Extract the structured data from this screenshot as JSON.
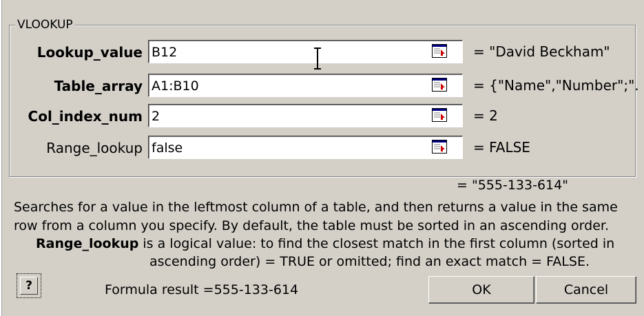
{
  "dialog": {
    "group_title": "VLOOKUP"
  },
  "args": [
    {
      "label": "Lookup_value",
      "value": "B12",
      "result": "= \"David Beckham\""
    },
    {
      "label": "Table_array",
      "value": "A1:B10",
      "result": "= {\"Name\",\"Number\";\"."
    },
    {
      "label": "Col_index_num",
      "value": "2",
      "result": "= 2"
    },
    {
      "label": "Range_lookup",
      "value": "false",
      "result": "= FALSE"
    }
  ],
  "formula_value": "= \"555-133-614\"",
  "description": {
    "line1": "Searches for a value in the leftmost column of a table, and then returns a value in the same",
    "line2": "row from a column you specify. By default, the table must be sorted in an ascending order.",
    "arg_name": "Range_lookup",
    "line3": " is a logical value: to find the closest match in the first column (sorted in",
    "line4": "ascending order) = TRUE or omitted; find an exact match = FALSE."
  },
  "formula_result": "Formula result =555-133-614",
  "buttons": {
    "ok": "OK",
    "cancel": "Cancel",
    "help": "?"
  },
  "icons": {
    "ref_button": "collapse-dialog-icon",
    "help": "help-icon"
  }
}
